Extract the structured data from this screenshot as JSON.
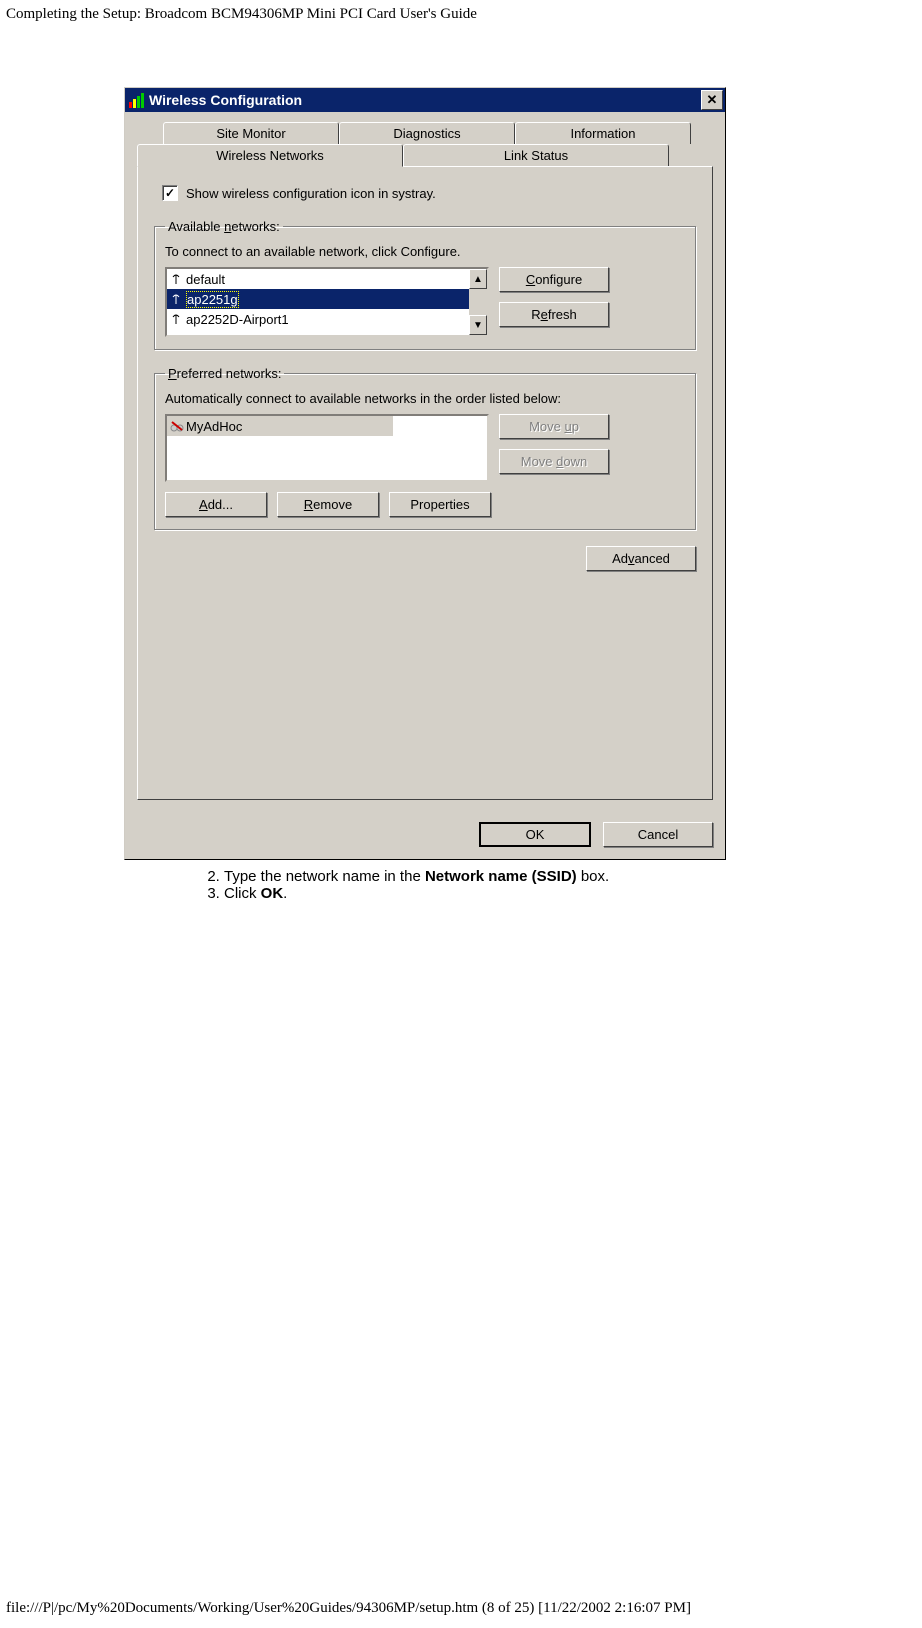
{
  "header": "Completing the Setup: Broadcom BCM94306MP Mini PCI Card User's Guide",
  "footer": "file:///P|/pc/My%20Documents/Working/User%20Guides/94306MP/setup.htm (8 of 25) [11/22/2002 2:16:07 PM]",
  "dialog": {
    "title": "Wireless Configuration",
    "tabs_top": [
      "Site Monitor",
      "Diagnostics",
      "Information"
    ],
    "tabs_bottom": [
      "Wireless Networks",
      "Link Status"
    ],
    "systray_label": "Show wireless configuration icon in systray.",
    "available": {
      "legend_pre": "Available ",
      "legend_u": "n",
      "legend_post": "etworks:",
      "text": "To connect to an available network, click Configure.",
      "items": [
        "default",
        "ap2251g",
        "ap2252D-Airport1"
      ],
      "btn_configure_u": "C",
      "btn_configure_post": "onfigure",
      "btn_refresh_pre": "R",
      "btn_refresh_u": "e",
      "btn_refresh_post": "fresh"
    },
    "preferred": {
      "legend_u": "P",
      "legend_post": "referred networks:",
      "text": "Automatically connect to available networks in the order listed below:",
      "items": [
        "MyAdHoc"
      ],
      "moveup_pre": "Move ",
      "moveup_u": "u",
      "moveup_post": "p",
      "movedown_pre": "Move ",
      "movedown_u": "d",
      "movedown_post": "own",
      "add_u": "A",
      "add_post": "dd...",
      "remove_u": "R",
      "remove_post": "emove",
      "props": "Properties"
    },
    "advanced_pre": "Ad",
    "advanced_u": "v",
    "advanced_post": "anced",
    "ok": "OK",
    "cancel": "Cancel"
  },
  "steps": {
    "s2a": "Type the network name in the ",
    "s2b": "Network name (SSID)",
    "s2c": " box.",
    "s3a": "Click ",
    "s3b": "OK",
    "s3c": "."
  }
}
